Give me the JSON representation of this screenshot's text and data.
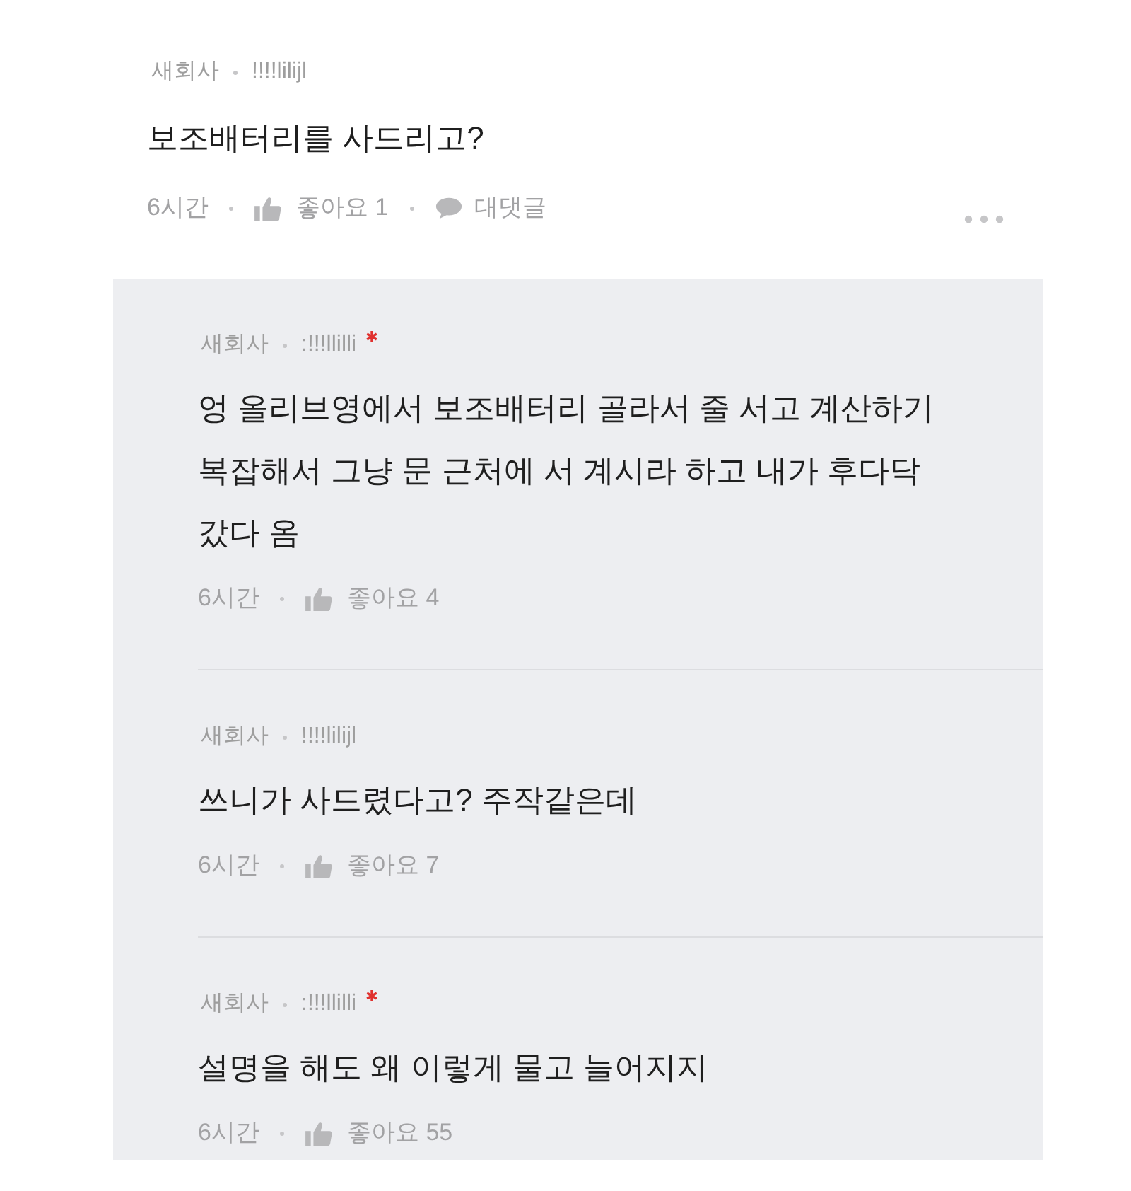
{
  "comment": {
    "company": "새회사",
    "nickname": "!!!!lilijl",
    "author": false,
    "text": "보조배터리를 사드리고?",
    "time": "6시간",
    "likes": "좋아요 1",
    "reply_label": "대댓글"
  },
  "replies": [
    {
      "company": "새회사",
      "nickname": ":!!!llilli",
      "author": true,
      "text": "엉 올리브영에서 보조배터리 골라서 줄 서고 계산하기 복잡해서 그냥 문 근처에 서 계시라 하고 내가 후다닥 갔다 옴",
      "time": "6시간",
      "likes": "좋아요 4"
    },
    {
      "company": "새회사",
      "nickname": "!!!!lilijl",
      "author": false,
      "text": "쓰니가 사드렸다고? 주작같은데",
      "time": "6시간",
      "likes": "좋아요 7"
    },
    {
      "company": "새회사",
      "nickname": ":!!!llilli",
      "author": true,
      "text": "설명을 해도 왜 이렇게 물고 늘어지지",
      "time": "6시간",
      "likes": "좋아요 55"
    }
  ]
}
